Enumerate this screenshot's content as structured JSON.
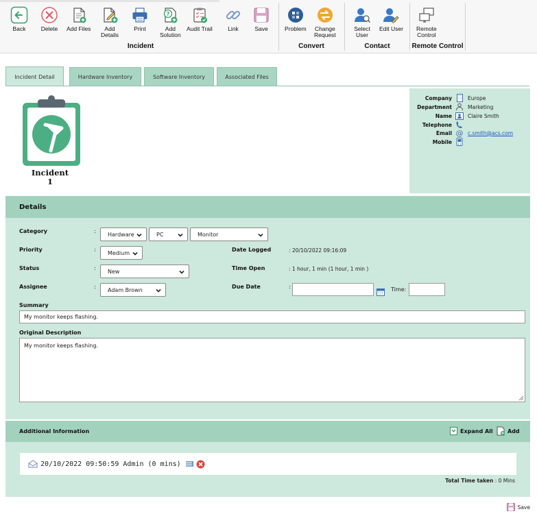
{
  "toolbar": {
    "incident_group": {
      "label": "Incident",
      "buttons": {
        "back": "Back",
        "delete": "Delete",
        "add_files": "Add Files",
        "add_details": "Add\nDetails",
        "print": "Print",
        "add_solution": "Add\nSolution",
        "audit_trail": "Audit Trail",
        "link": "Link",
        "save": "Save"
      }
    },
    "convert_group": {
      "label": "Convert",
      "buttons": {
        "problem": "Problem",
        "change_request": "Change\nRequest"
      }
    },
    "contact_group": {
      "label": "Contact",
      "buttons": {
        "select_user": "Select\nUser",
        "edit_user": "Edit User"
      }
    },
    "remote_group": {
      "label": "Remote Control",
      "buttons": {
        "remote_control": "Remote\nControl"
      }
    }
  },
  "tabs": [
    {
      "label": "Incident Detail",
      "active": true
    },
    {
      "label": "Hardware Inventory",
      "active": false
    },
    {
      "label": "Software Inventory",
      "active": false
    },
    {
      "label": "Associated Files",
      "active": false
    }
  ],
  "incident": {
    "title": "Incident",
    "number": "1"
  },
  "contact": {
    "company": {
      "label": "Company",
      "value": "Europe"
    },
    "department": {
      "label": "Department",
      "value": "Marketing"
    },
    "name": {
      "label": "Name",
      "value": "Claire Smith"
    },
    "telephone": {
      "label": "Telephone",
      "value": ""
    },
    "email": {
      "label": "Email",
      "value": "c.smith@acs.com"
    },
    "mobile": {
      "label": "Mobile",
      "value": ""
    }
  },
  "details": {
    "heading": "Details",
    "colon": ":",
    "category": {
      "label": "Category",
      "values": [
        "Hardware",
        "PC",
        "Monitor"
      ]
    },
    "priority": {
      "label": "Priority",
      "value": "Medium"
    },
    "status": {
      "label": "Status",
      "value": "New"
    },
    "assignee": {
      "label": "Assignee",
      "value": "Adam Brown"
    },
    "date_logged": {
      "label": "Date Logged",
      "value": ": 20/10/2022 09:16:09"
    },
    "time_open": {
      "label": "Time Open",
      "value": ": 1 hour, 1 min  (1 hour, 1 min )"
    },
    "due_date": {
      "label": "Due Date",
      "value": "",
      "time_label": "Time:",
      "time_value": ""
    },
    "summary": {
      "label": "Summary",
      "value": "My monitor keeps flashing."
    },
    "description": {
      "label": "Original Description",
      "value": "My monitor keeps flashing."
    }
  },
  "additional": {
    "heading": "Additional Information",
    "expand_all": "Expand All",
    "add": "Add",
    "note": "20/10/2022 09:50:59 Admin (0 mins)",
    "total_label": "Total Time taken",
    "total_value": ": 0 Mins"
  },
  "footer": {
    "save": "Save"
  },
  "colors": {
    "accent": "#a2d2bd",
    "panel": "#cde8dc",
    "clipboard": "#4caf83",
    "link": "#1a56c4"
  }
}
